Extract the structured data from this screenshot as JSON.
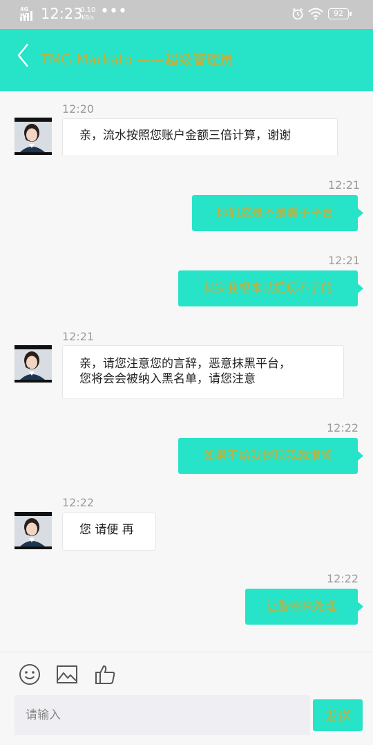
{
  "status_bar": {
    "network": "4G HD",
    "time": "12:23",
    "speed_value": "0.10",
    "speed_unit": "KB/s",
    "more": "•••",
    "battery": "92"
  },
  "header": {
    "title": "TMG Markato ——超级管理员",
    "back_icon": "chevron-left-icon"
  },
  "messages": [
    {
      "side": "in",
      "time": "12:20",
      "text": "亲，流水按照您账户金额三倍计算，谢谢"
    },
    {
      "side": "out",
      "time": "12:21",
      "text": "你们这是不是骗子平台"
    },
    {
      "side": "out",
      "time": "12:21",
      "text": "其实我根本就提现不了的"
    },
    {
      "side": "in",
      "time": "12:21",
      "lines": [
        "亲，请您注意您的言辞，恶意抹黑平台，",
        "您将会会被纳入黑名单，请您注意"
      ]
    },
    {
      "side": "out",
      "time": "12:22",
      "text": "如果不给我提现我就报警"
    },
    {
      "side": "in",
      "time": "12:22",
      "text": "您 请便 再"
    },
    {
      "side": "out",
      "time": "12:22",
      "text": "让警察来处理"
    }
  ],
  "input_bar": {
    "tools": [
      "smiley-icon",
      "image-icon",
      "thumbs-up-icon"
    ],
    "placeholder": "请输入",
    "send_label": "发送"
  },
  "colors": {
    "accent": "#27e3c8",
    "title_text": "#c1b13f",
    "background": "#f7f7f7",
    "status_bar": "#c8c8c8"
  }
}
